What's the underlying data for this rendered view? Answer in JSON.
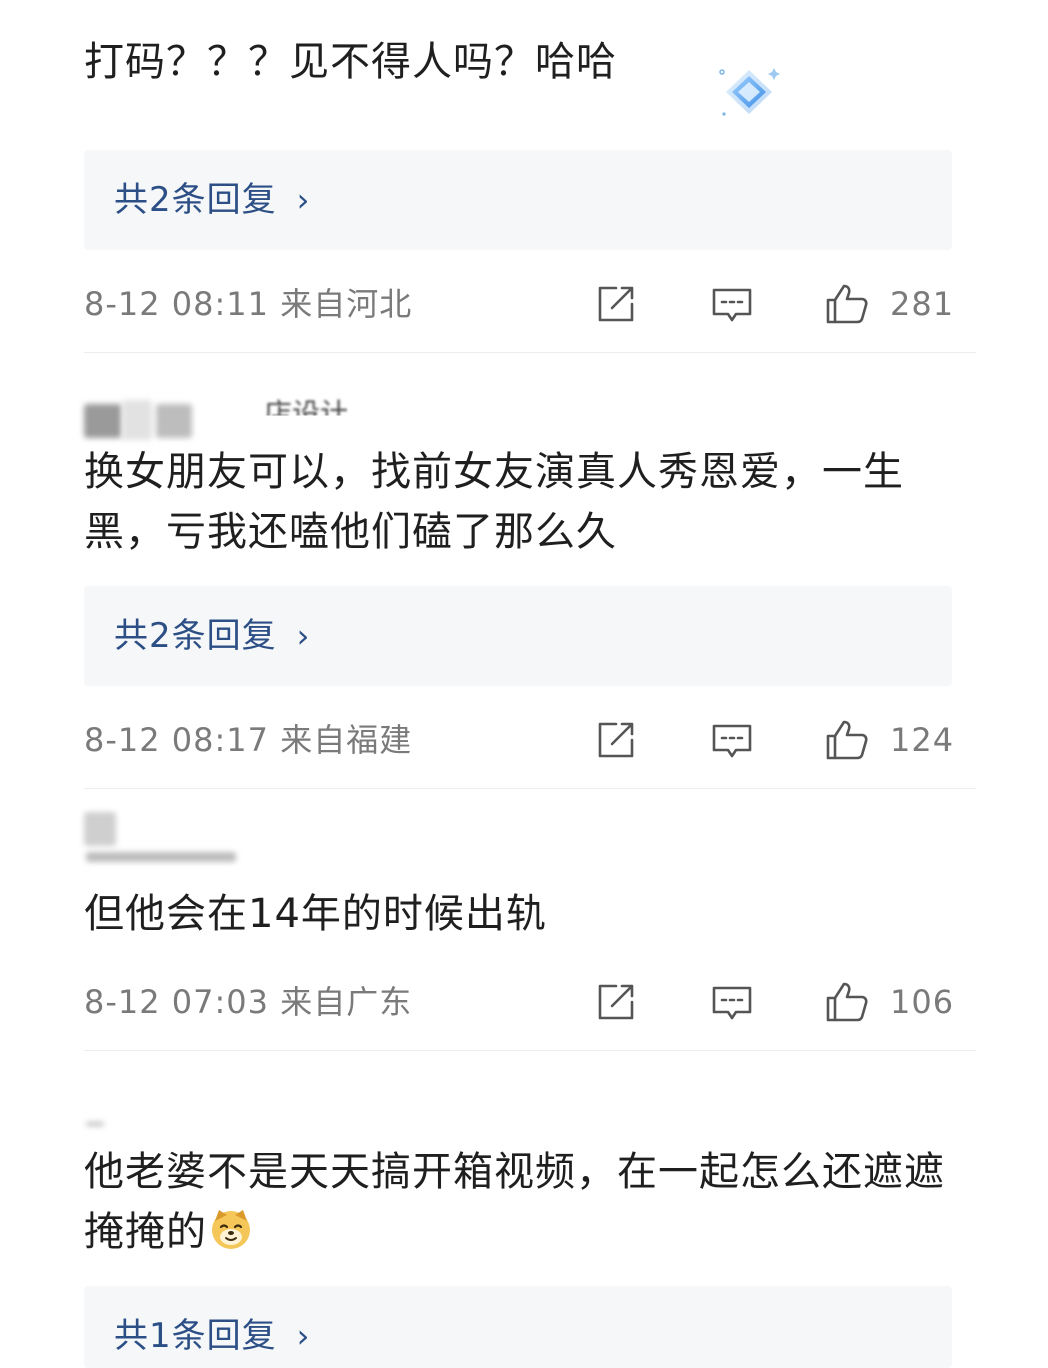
{
  "comments": [
    {
      "text": "打码？？？见不得人吗？哈哈",
      "replies_label": "共2条回复",
      "timestamp": "8-12 08:11",
      "location": "来自河北",
      "likes": "281"
    },
    {
      "username_partial": "店设计",
      "text": "换女朋友可以，找前女友演真人秀恩爱，一生黑，亏我还嗑他们磕了那么久",
      "replies_label": "共2条回复",
      "timestamp": "8-12 08:17",
      "location": "来自福建",
      "likes": "124"
    },
    {
      "text": "但他会在14年的时候出轨",
      "timestamp": "8-12 07:03",
      "location": "来自广东",
      "likes": "106"
    },
    {
      "text": "他老婆不是天天搞开箱视频，在一起怎么还遮遮掩掩的",
      "replies_label": "共1条回复"
    }
  ],
  "icons": {
    "share": "share-icon",
    "comment": "comment-icon",
    "like": "thumbs-up-icon",
    "badge": "diamond-badge-icon",
    "emoji": "dog-emoji-icon"
  },
  "colors": {
    "link": "#2c4f86",
    "meta": "#7a7a7a",
    "reply_bg": "#f6f7f9",
    "badge": "#5aa6ef"
  }
}
